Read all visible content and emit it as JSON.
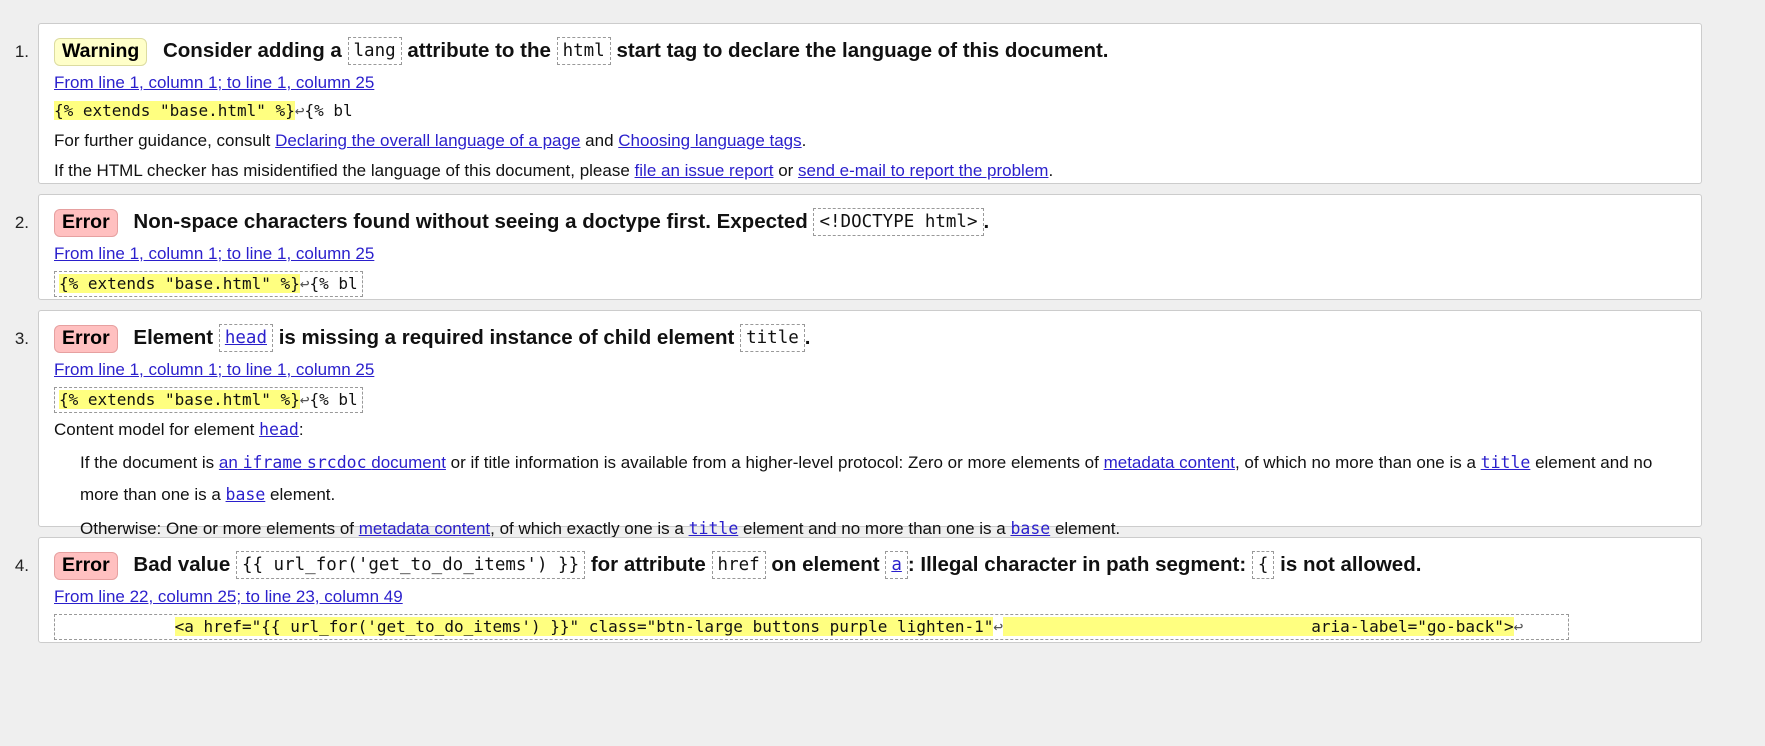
{
  "messages": [
    {
      "number": "1.",
      "type_label": "Warning",
      "h_part1": "Consider adding a",
      "h_code1": "lang",
      "h_part2": "attribute to the",
      "h_code2": "html",
      "h_part3": "start tag to declare the language of this document.",
      "location": "From line 1, column 1; to line 1, column 25",
      "extract_highlight": "{% extends \"base.html\" %}",
      "extract_lf": "↩",
      "extract_tail": "{% bl",
      "guidance_prefix": "For further guidance, consult",
      "guidance_link1": "Declaring the overall language of a page",
      "guidance_and": "and",
      "guidance_link2": "Choosing language tags",
      "guidance_end": ".",
      "report_prefix": "If the HTML checker has misidentified the language of this document, please",
      "report_link1": "file an issue report",
      "report_or": "or",
      "report_link2": "send e-mail to report the problem",
      "report_end": "."
    },
    {
      "number": "2.",
      "type_label": "Error",
      "h_part1": "Non-space characters found without seeing a doctype first. Expected",
      "h_code1": "<!DOCTYPE html>",
      "h_end": ".",
      "location": "From line 1, column 1; to line 1, column 25",
      "extract_highlight": "{% extends \"base.html\" %}",
      "extract_lf": "↩",
      "extract_tail": "{% bl"
    },
    {
      "number": "3.",
      "type_label": "Error",
      "h_part1": "Element",
      "h_code1": "head",
      "h_part2": "is missing a required instance of child element",
      "h_code2": "title",
      "h_end": ".",
      "location": "From line 1, column 1; to line 1, column 25",
      "extract_highlight": "{% extends \"base.html\" %}",
      "extract_lf": "↩",
      "extract_tail": "{% bl",
      "cm_prefix": "Content model for element",
      "cm_element": "head",
      "cm_colon": ":",
      "cm1_a": "If the document is",
      "cm1_link_an": "an",
      "cm1_link_iframe": "iframe",
      "cm1_link_srcdoc": "srcdoc",
      "cm1_link_document": "document",
      "cm1_b": "or if title information is available from a higher-level protocol: Zero or more elements of",
      "cm1_link_metadata": "metadata content",
      "cm1_c": ", of which no more than one is a",
      "cm1_code_title": "title",
      "cm1_d": "element and no more than one is a",
      "cm1_code_base": "base",
      "cm1_e": "element.",
      "cm2_a": "Otherwise: One or more elements of",
      "cm2_link_metadata": "metadata content",
      "cm2_b": ", of which exactly one is a",
      "cm2_code_title": "title",
      "cm2_c": "element and no more than one is a",
      "cm2_code_base": "base",
      "cm2_d": "element."
    },
    {
      "number": "4.",
      "type_label": "Error",
      "h_part1": "Bad value",
      "h_code1": "{{ url_for('get_to_do_items') }}",
      "h_part2": "for attribute",
      "h_code2": "href",
      "h_part3": "on element",
      "h_code3": "a",
      "h_part4": ": Illegal character in path segment:",
      "h_code4": "{",
      "h_part5": "is not allowed.",
      "location": "From line 22, column 25; to line 23, column 49",
      "extract_indent": "            ",
      "extract_highlight": "<a href=\"{{ url_for('get_to_do_items') }}\" class=\"btn-large buttons purple lighten-1\"",
      "extract_lf1": "↩",
      "extract_middle": "                                ",
      "extract_highlight2": "aria-label=\"go-back\">",
      "extract_lf2": "↩"
    }
  ],
  "colors": {
    "warning_badge": "#ffffc9",
    "error_badge": "#ffc0c0",
    "highlight": "#ffff80",
    "link": "#2a1fcc"
  }
}
